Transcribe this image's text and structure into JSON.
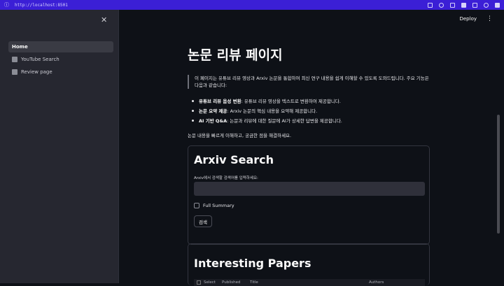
{
  "browser": {
    "url": "http://localhost:8501"
  },
  "sidebar": {
    "items": [
      {
        "label": "Home",
        "active": true
      },
      {
        "label": "YouTube Search",
        "active": false
      },
      {
        "label": "Review page",
        "active": false
      }
    ]
  },
  "toolbar": {
    "deploy_label": "Deploy"
  },
  "page": {
    "title": "논문 리뷰 페이지",
    "intro": "이 페이지는 유튜브 리뷰 영상과 Arxiv 논문을 통합하여 최신 연구 내용을 쉽게 이해할 수 있도록 도와드립니다. 주요 기능은 다음과 같습니다:",
    "features": [
      {
        "title": "유튜브 리뷰 음성 변환",
        "desc": ": 유튜브 리뷰 영상을 텍스트로 변환하여 제공합니다."
      },
      {
        "title": "논문 요약 제공",
        "desc": ": Arxiv 논문의 핵심 내용을 요약해 제공합니다."
      },
      {
        "title": "AI 기반 Q&A",
        "desc": ": 논문과 리뷰에 대한 질문에 AI가 상세한 답변을 제공합니다."
      }
    ],
    "summary": "논문 내용을 빠르게 이해하고, 궁금한 점을 해결하세요."
  },
  "arxiv": {
    "title": "Arxiv Search",
    "input_label": "Arxiv에서 검색할 검색어를 입력하세요:",
    "input_value": "",
    "checkbox_label": "Full Summary",
    "button_label": "검색"
  },
  "papers": {
    "title": "Interesting Papers",
    "columns": [
      "Select",
      "Published",
      "Title",
      "Authors"
    ]
  }
}
